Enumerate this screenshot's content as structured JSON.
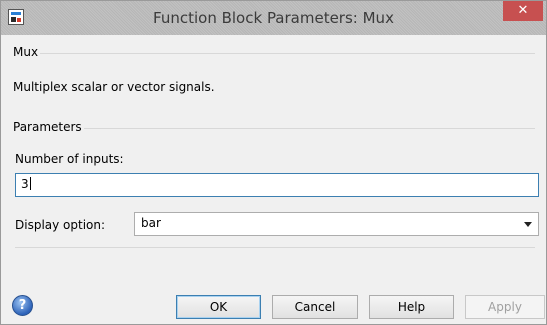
{
  "window": {
    "title": "Function Block Parameters: Mux",
    "close_glyph": "✕"
  },
  "block_section": {
    "group_label": "Mux",
    "description": "Multiplex scalar or vector signals."
  },
  "parameters": {
    "group_label": "Parameters",
    "inputs_label": "Number of inputs:",
    "inputs_value": "3",
    "display_label": "Display option:",
    "display_selected": "bar"
  },
  "buttons": {
    "ok": "OK",
    "cancel": "Cancel",
    "help": "Help",
    "apply": "Apply"
  },
  "help_glyph": "?",
  "colors": {
    "focus_border": "#3c7fb1",
    "close_button": "#c75050"
  }
}
